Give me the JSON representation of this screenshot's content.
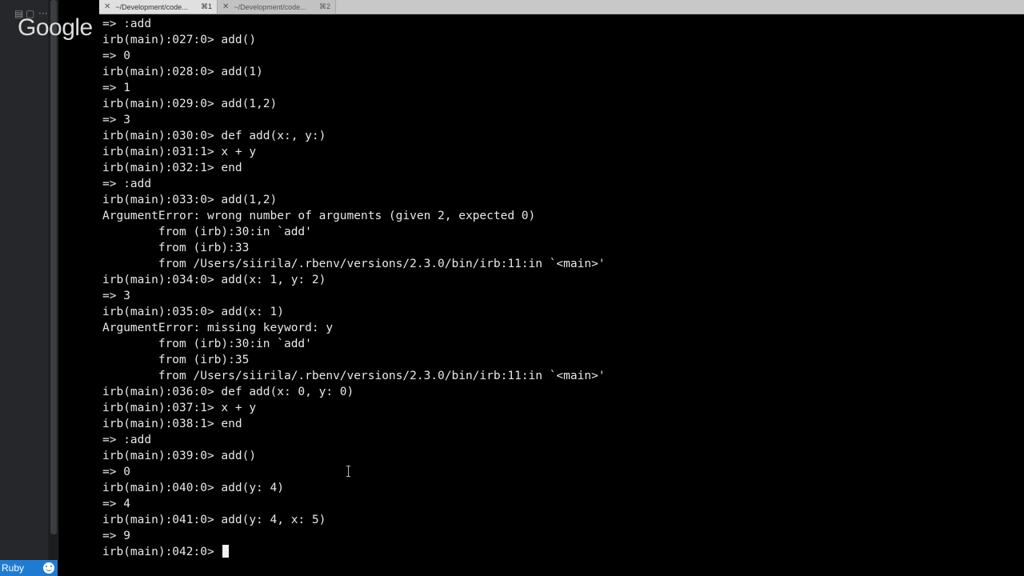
{
  "watermark": {
    "text": "Google"
  },
  "status": {
    "language": "Ruby"
  },
  "tabs": [
    {
      "title": "~/Development/code...",
      "shortcut": "⌘1",
      "active": true
    },
    {
      "title": "~/Development/code...",
      "shortcut": "⌘2",
      "active": false
    }
  ],
  "terminal": {
    "lines": [
      "=> :add",
      "irb(main):027:0> add()",
      "=> 0",
      "irb(main):028:0> add(1)",
      "=> 1",
      "irb(main):029:0> add(1,2)",
      "=> 3",
      "irb(main):030:0> def add(x:, y:)",
      "irb(main):031:1> x + y",
      "irb(main):032:1> end",
      "=> :add",
      "irb(main):033:0> add(1,2)",
      "ArgumentError: wrong number of arguments (given 2, expected 0)",
      "        from (irb):30:in `add'",
      "        from (irb):33",
      "        from /Users/siirila/.rbenv/versions/2.3.0/bin/irb:11:in `<main>'",
      "irb(main):034:0> add(x: 1, y: 2)",
      "=> 3",
      "irb(main):035:0> add(x: 1)",
      "ArgumentError: missing keyword: y",
      "        from (irb):30:in `add'",
      "        from (irb):35",
      "        from /Users/siirila/.rbenv/versions/2.3.0/bin/irb:11:in `<main>'",
      "irb(main):036:0> def add(x: 0, y: 0)",
      "irb(main):037:1> x + y",
      "irb(main):038:1> end",
      "=> :add",
      "irb(main):039:0> add()",
      "=> 0",
      "irb(main):040:0> add(y: 4)",
      "=> 4",
      "irb(main):041:0> add(y: 4, x: 5)",
      "=> 9"
    ],
    "prompt": "irb(main):042:0> "
  }
}
